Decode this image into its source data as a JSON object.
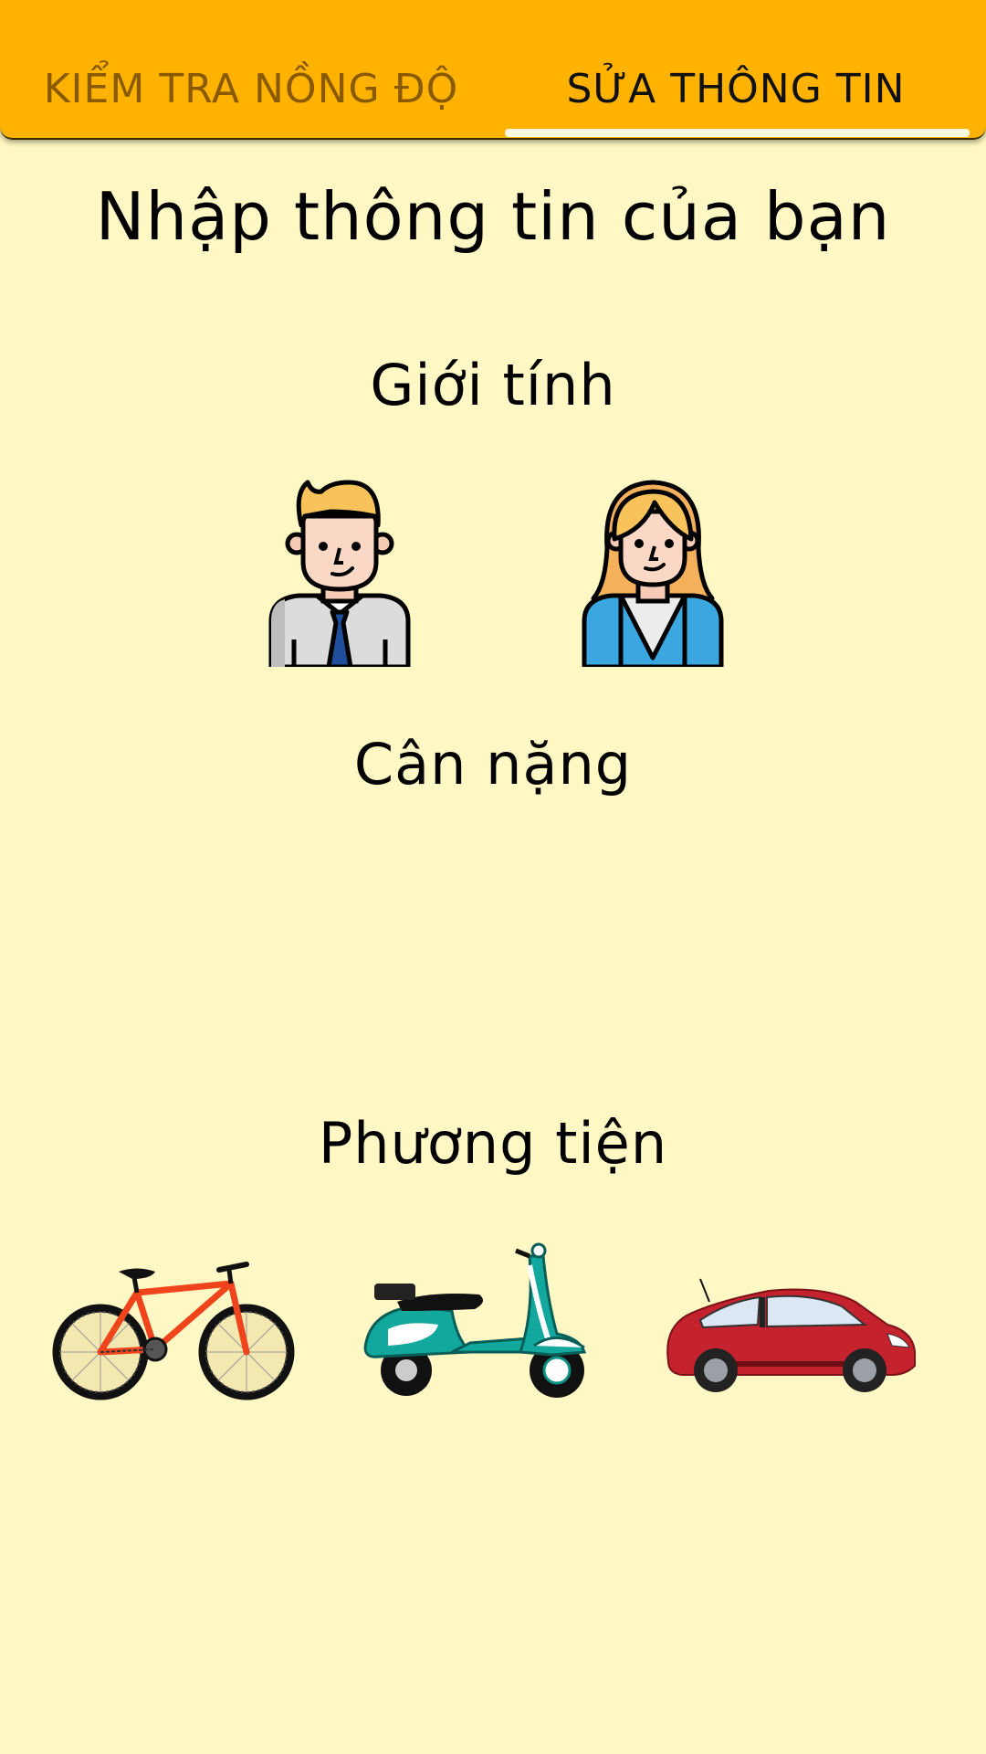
{
  "tabs": {
    "tab1_label": "KIỂM TRA NỒNG ĐỘ",
    "tab2_label": "SỬA THÔNG TIN",
    "active": "SỬA THÔNG TIN"
  },
  "form": {
    "title": "Nhập thông tin của bạn",
    "gender_label": "Giới tính",
    "weight_label": "Cân nặng",
    "vehicle_label": "Phương tiện"
  },
  "gender_options": [
    "male-avatar-icon",
    "female-avatar-icon"
  ],
  "vehicle_options": [
    "bicycle-icon",
    "scooter-icon",
    "car-icon"
  ],
  "colors": {
    "background": "#fff8c4",
    "tab_bar": "#ffb300",
    "active_tab_text": "#111111",
    "inactive_tab_text": "#8a5a00",
    "indicator": "#fffbe0"
  }
}
